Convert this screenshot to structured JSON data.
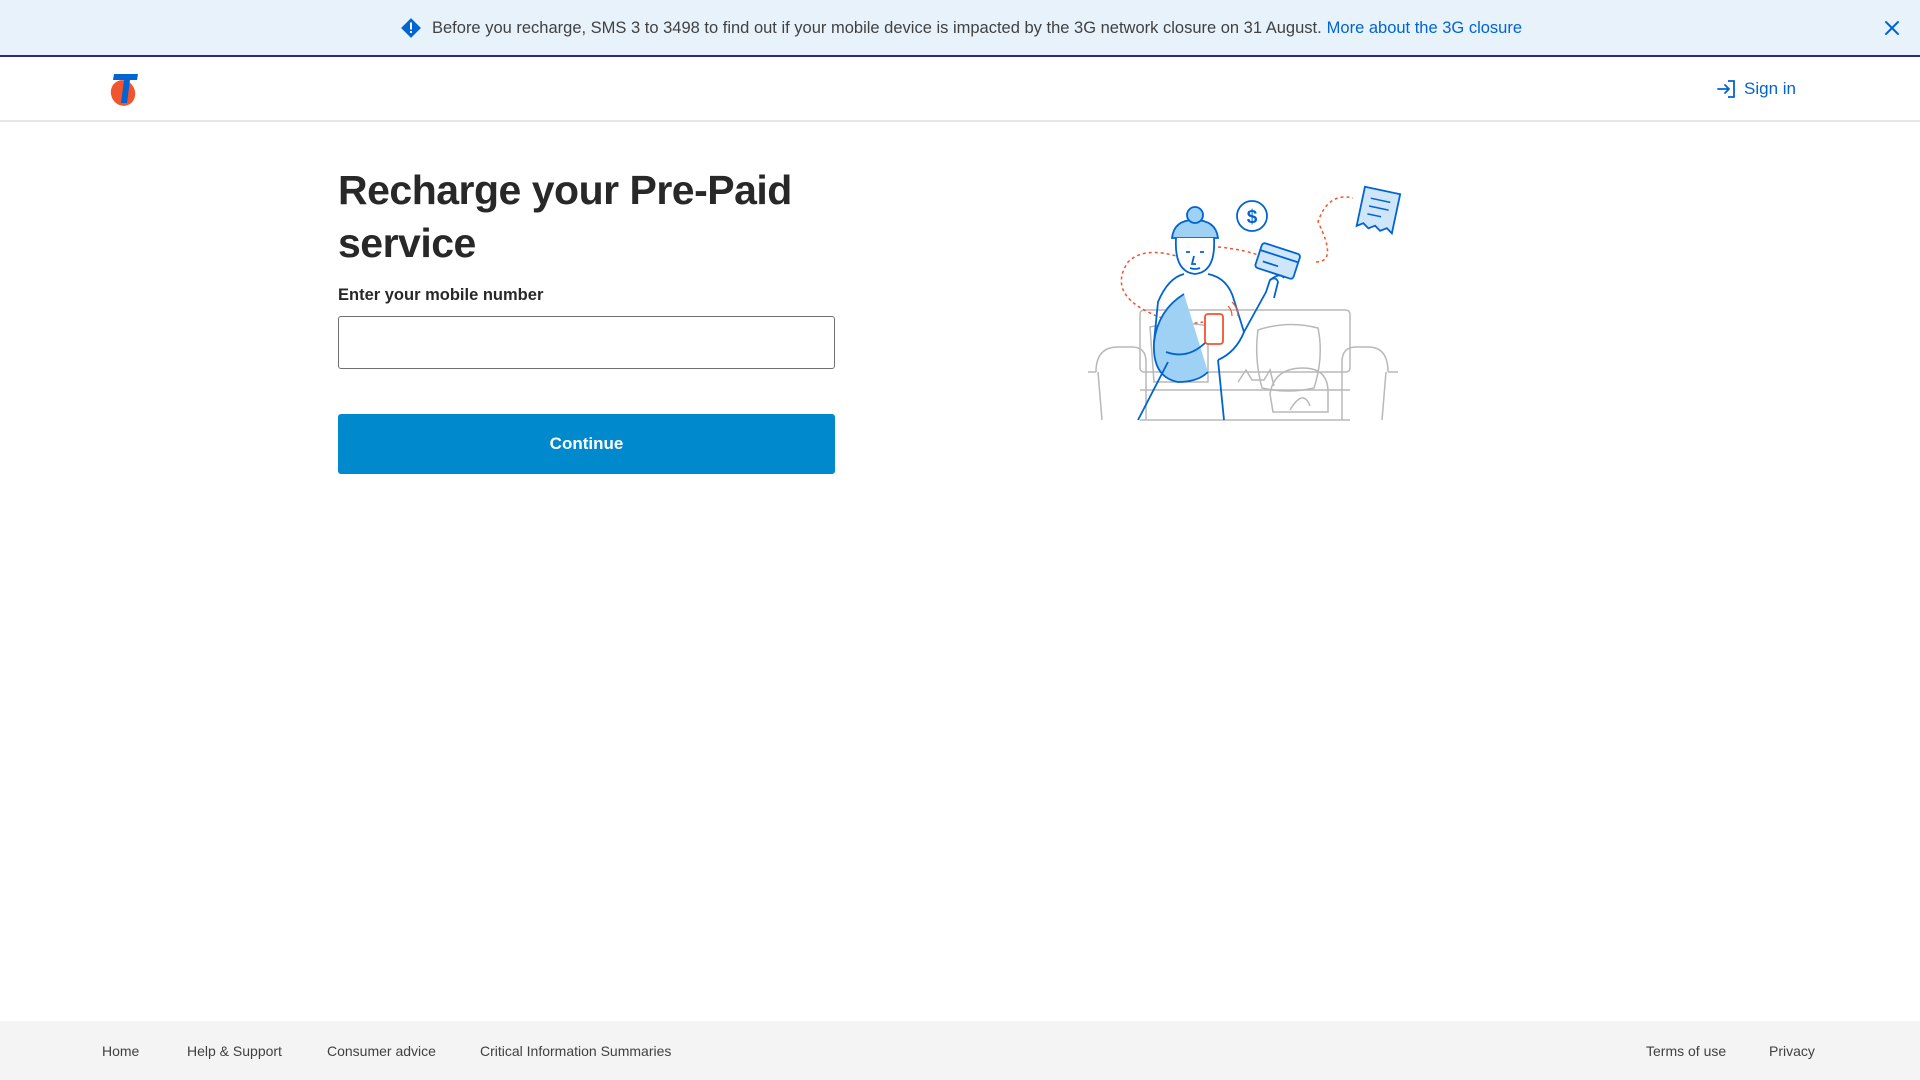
{
  "banner": {
    "icon": "alert-diamond-icon",
    "message": "Before you recharge, SMS 3 to 3498 to find out if your mobile device is impacted by the 3G network closure on 31 August.",
    "link_label": "More about the 3G closure",
    "close_icon": "close-icon"
  },
  "header": {
    "logo": "telstra-logo",
    "signin_icon": "sign-in-icon",
    "signin_label": "Sign in"
  },
  "main": {
    "title": "Recharge your Pre-Paid service",
    "mobile_label": "Enter your mobile number",
    "mobile_value": "",
    "mobile_placeholder": "",
    "continue_label": "Continue",
    "illustration": "person-paying-on-phone-illustration"
  },
  "footer": {
    "links": [
      "Home",
      "Help & Support",
      "Consumer advice",
      "Critical Information Summaries"
    ],
    "right_links": [
      "Terms of use",
      "Privacy"
    ]
  },
  "colors": {
    "accent": "#0064d2",
    "button": "#0089cc",
    "banner_bg": "#e8f2fb",
    "logo_orange": "#f2542d",
    "logo_blue": "#0064d2"
  }
}
